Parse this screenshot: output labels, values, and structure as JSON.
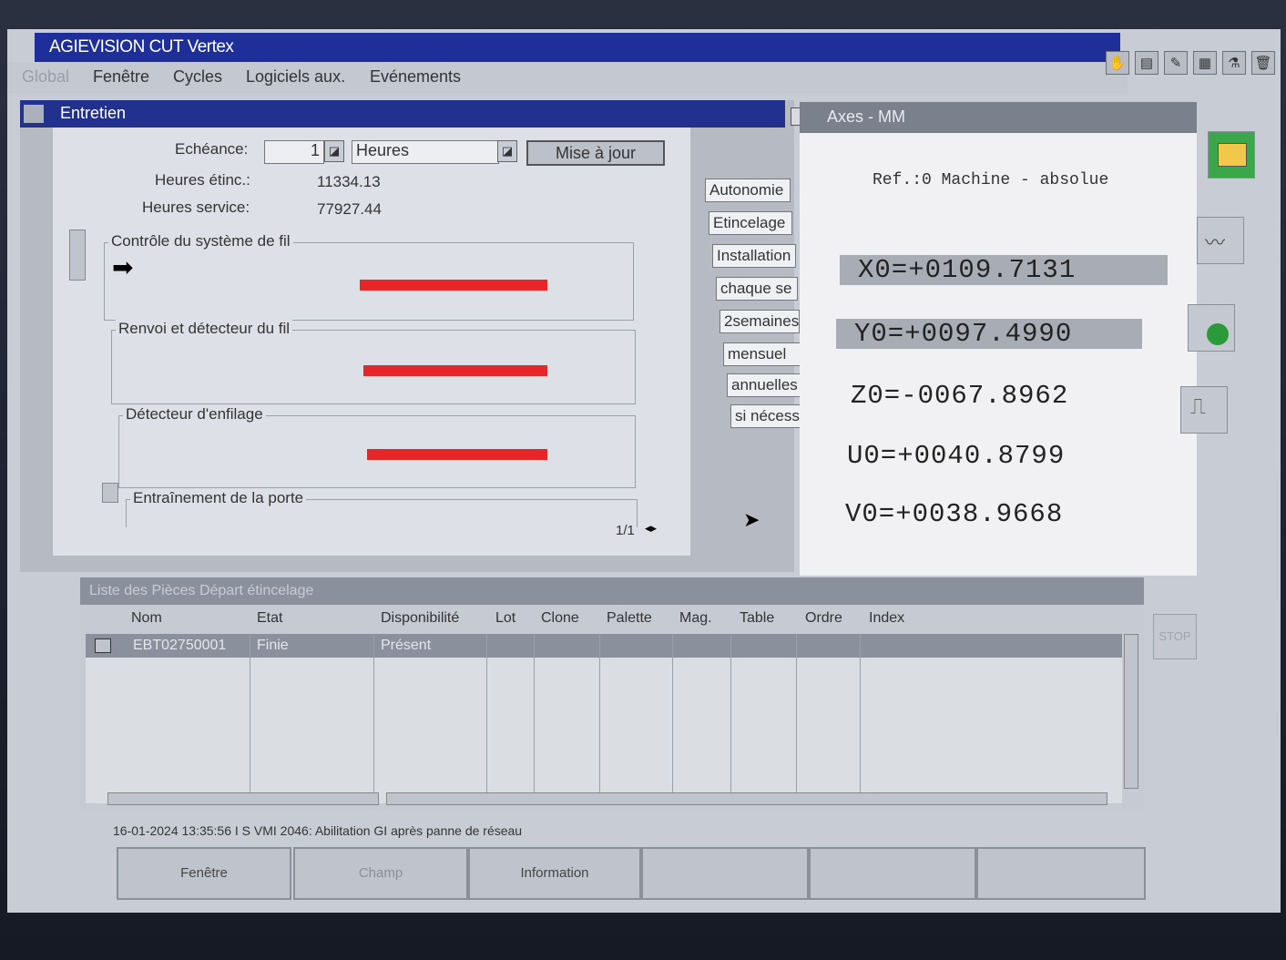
{
  "titlebar": {
    "title": "AGIEVISION CUT Vertex"
  },
  "menu": {
    "items": [
      {
        "label": "Global",
        "disabled": true
      },
      {
        "label": "Fenêtre"
      },
      {
        "label": "Cycles"
      },
      {
        "label": "Logiciels aux."
      },
      {
        "label": "Evénements"
      }
    ]
  },
  "toolbar_icons": [
    "hand-icon",
    "chart-icon",
    "edit-icon",
    "grid-icon",
    "flask-icon",
    "trash-icon"
  ],
  "maintenance": {
    "title": "Entretien",
    "echeance_label": "Echéance:",
    "echeance_value": "1",
    "unit_value": "Heures",
    "update_button": "Mise à jour",
    "heures_etinc_label": "Heures étinc.:",
    "heures_etinc_value": "11334.13",
    "heures_service_label": "Heures service:",
    "heures_service_value": "77927.44",
    "groups": [
      {
        "label": "Contrôle du système de fil"
      },
      {
        "label": "Renvoi et détecteur du fil"
      },
      {
        "label": "Détecteur d'enfilage"
      },
      {
        "label": "Entraînement de la porte"
      }
    ],
    "pager": "1/1",
    "tabs": [
      "Autonomie",
      "Etincelage",
      "Installation",
      "chaque se",
      "2semaines",
      "mensuel",
      "annuelles",
      "si nécessa"
    ]
  },
  "axes": {
    "title": "Axes - MM",
    "ref": "Ref.:0 Machine - absolue",
    "values": [
      {
        "label": "X0=+0109.7131"
      },
      {
        "label": "Y0=+0097.4990"
      },
      {
        "label": "Z0=-0067.8962"
      },
      {
        "label": "U0=+0040.8799"
      },
      {
        "label": "V0=+0038.9668"
      }
    ]
  },
  "right_icons": [
    "mail-icon",
    "waveform-icon",
    "probe-icon",
    "step-icon"
  ],
  "stop_label": "STOP",
  "parts_list": {
    "title": "Liste des Pièces Départ étincelage",
    "columns": [
      "Nom",
      "Etat",
      "Disponibilité",
      "Lot",
      "Clone",
      "Palette",
      "Mag.",
      "Table",
      "Ordre",
      "Index"
    ],
    "rows": [
      {
        "nom": "EBT02750001",
        "etat": "Finie",
        "disponibilite": "Présent"
      }
    ]
  },
  "status_message": "16-01-2024 13:35:56 I S VMI 2046: Abilitation GI après panne de réseau",
  "bottom_buttons": [
    "Fenêtre",
    "Champ",
    "Information",
    "",
    "",
    ""
  ],
  "colors": {
    "titlebar": "#1f2f9a",
    "redbar": "#e8262a",
    "screen": "#c8ccd4"
  }
}
